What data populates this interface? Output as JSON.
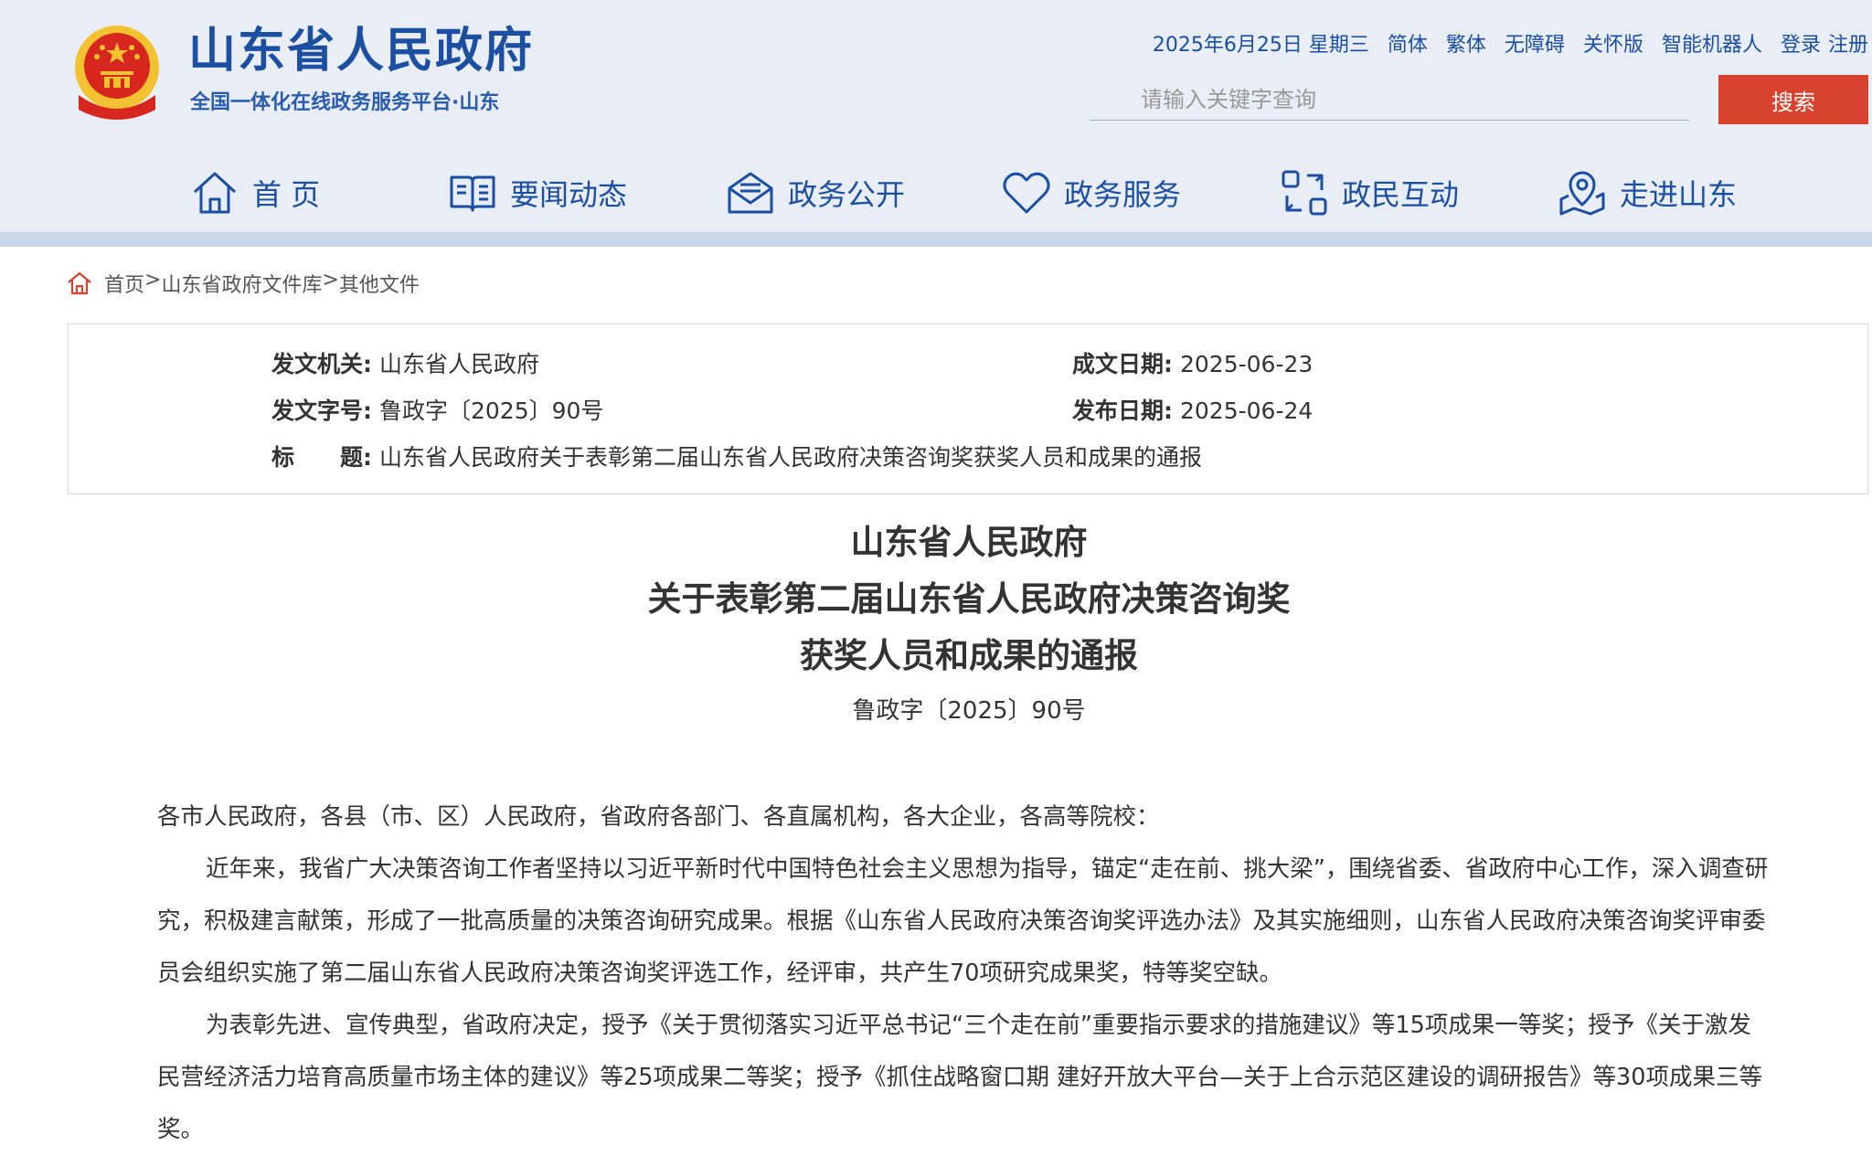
{
  "site": {
    "title": "山东省人民政府",
    "subtitle": "全国一体化在线政务服务平台·山东",
    "emblem": "national-emblem"
  },
  "toplinks": {
    "date": "2025年6月25日 星期三",
    "simplified": "简体",
    "traditional": "繁体",
    "accessible": "无障碍",
    "care_mode": "关怀版",
    "robot": "智能机器人",
    "login": "登录",
    "register": "注册"
  },
  "search": {
    "placeholder": "请输入关键字查询",
    "button": "搜索"
  },
  "nav": [
    {
      "label": "首 页",
      "icon": "home-icon"
    },
    {
      "label": "要闻动态",
      "icon": "book-icon"
    },
    {
      "label": "政务公开",
      "icon": "mail-icon"
    },
    {
      "label": "政务服务",
      "icon": "heart-icon"
    },
    {
      "label": "政民互动",
      "icon": "interaction-icon"
    },
    {
      "label": "走进山东",
      "icon": "location-icon"
    }
  ],
  "breadcrumb": [
    "首页",
    ">",
    "山东省政府文件库",
    ">",
    "其他文件"
  ],
  "meta": {
    "issuer_label": "发文机关:",
    "issuer": "山东省人民政府",
    "created_label": "成文日期:",
    "created": "2025-06-23",
    "number_label": "发文字号:",
    "number": "鲁政字〔2025〕90号",
    "published_label": "发布日期:",
    "published": "2025-06-24",
    "title_label": "标　　题:",
    "title": "山东省人民政府关于表彰第二届山东省人民政府决策咨询奖获奖人员和成果的通报"
  },
  "document": {
    "title_lines": [
      "山东省人民政府",
      "关于表彰第二届山东省人民政府决策咨询奖",
      "获奖人员和成果的通报"
    ],
    "number": "鲁政字〔2025〕90号",
    "paragraphs": [
      "各市人民政府，各县（市、区）人民政府，省政府各部门、各直属机构，各大企业，各高等院校：",
      "近年来，我省广大决策咨询工作者坚持以习近平新时代中国特色社会主义思想为指导，锚定“走在前、挑大梁”，围绕省委、省政府中心工作，深入调查研究，积极建言献策，形成了一批高质量的决策咨询研究成果。根据《山东省人民政府决策咨询奖评选办法》及其实施细则，山东省人民政府决策咨询奖评审委员会组织实施了第二届山东省人民政府决策咨询奖评选工作，经评审，共产生70项研究成果奖，特等奖空缺。",
      "为表彰先进、宣传典型，省政府决定，授予《关于贯彻落实习近平总书记“三个走在前”重要指示要求的措施建议》等15项成果一等奖；授予《关于激发民营经济活力培育高质量市场主体的建议》等25项成果二等奖；授予《抓住战略窗口期 建好开放大平台—关于上合示范区建设的调研报告》等30项成果三等奖。"
    ]
  },
  "colors": {
    "brand_blue": "#1c4fa1",
    "header_bg": "#e9eef6",
    "search_button": "#d8432f",
    "emblem_red": "#d7261e",
    "emblem_gold": "#f2c230"
  }
}
